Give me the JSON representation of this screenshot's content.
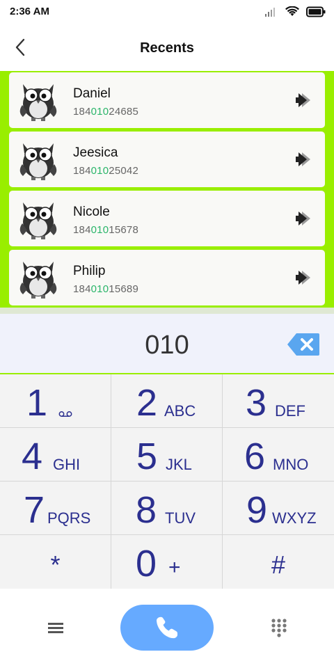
{
  "status_bar": {
    "time": "2:36 AM"
  },
  "header": {
    "title": "Recents"
  },
  "recents": [
    {
      "name": "Daniel",
      "number_prefix": "184",
      "number_match": "010",
      "number_suffix": "24685"
    },
    {
      "name": "Jeesica",
      "number_prefix": "184",
      "number_match": "010",
      "number_suffix": "25042"
    },
    {
      "name": "Nicole",
      "number_prefix": "184",
      "number_match": "010",
      "number_suffix": "15678"
    },
    {
      "name": "Philip",
      "number_prefix": "184",
      "number_match": "010",
      "number_suffix": "15689"
    }
  ],
  "display": {
    "dialed": "010"
  },
  "keypad": {
    "keys": [
      {
        "digit": "1",
        "letters": ""
      },
      {
        "digit": "2",
        "letters": "ABC"
      },
      {
        "digit": "3",
        "letters": "DEF"
      },
      {
        "digit": "4",
        "letters": "GHI"
      },
      {
        "digit": "5",
        "letters": "JKL"
      },
      {
        "digit": "6",
        "letters": "MNO"
      },
      {
        "digit": "7",
        "letters": "PQRS"
      },
      {
        "digit": "8",
        "letters": "TUV"
      },
      {
        "digit": "9",
        "letters": "WXYZ"
      }
    ],
    "star": "*",
    "zero": {
      "digit": "0",
      "letters": "+"
    },
    "hash": "#"
  },
  "icons": {
    "back": "back-chevron-icon",
    "voicemail": "voicemail-icon",
    "backspace": "backspace-icon",
    "menu": "menu-icon",
    "call": "phone-icon",
    "dialpad": "dialpad-icon",
    "row_action": "double-arrow-icon"
  },
  "colors": {
    "accent_green": "#99ee00",
    "match_green": "#2bb56a",
    "keypad_text": "#2b2f8f",
    "call_button": "#66aaff",
    "backspace": "#5aa6ef"
  }
}
